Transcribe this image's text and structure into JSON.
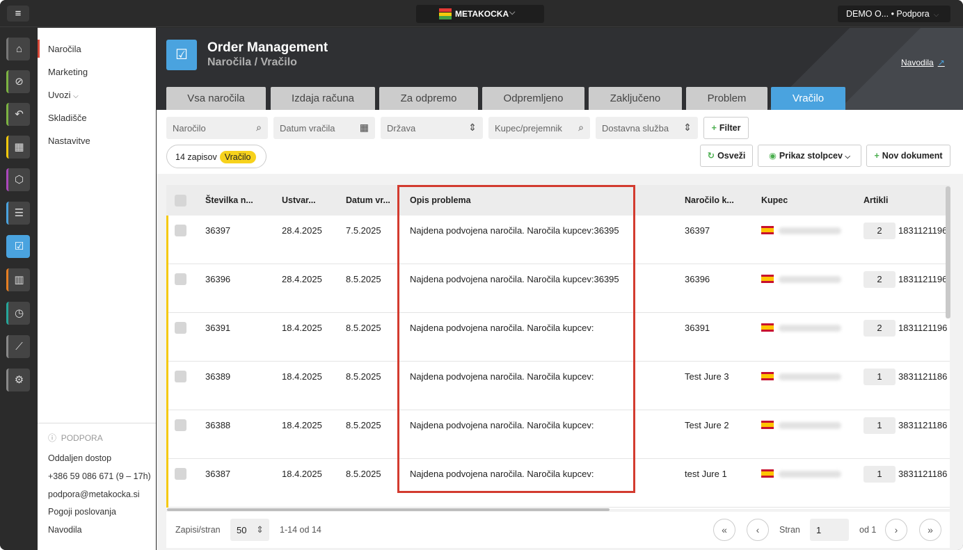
{
  "brand": {
    "name": "METAKOCKA",
    "logo_colors": [
      "#e53935",
      "#f5c90c",
      "#43a047"
    ]
  },
  "account": {
    "label": "DEMO O... • Podpora"
  },
  "icons": [
    "home-icon",
    "tag-icon",
    "return-icon",
    "calendar-icon",
    "box-icon",
    "invoice-icon",
    "order-icon",
    "factory-icon",
    "clock-icon",
    "chart-icon",
    "gear-icon"
  ],
  "nav": {
    "items": [
      "Naročila",
      "Marketing",
      "Uvozi",
      "Skladišče",
      "Nastavitve"
    ],
    "active": "Naročila"
  },
  "support": {
    "title": "PODPORA",
    "items": [
      "Oddaljen dostop",
      "+386 59 086 671 (9 – 17h)",
      "podpora@metakocka.si",
      "Pogoji poslovanja",
      "Navodila"
    ]
  },
  "header": {
    "title": "Order Management",
    "subtitle": "Naročila / Vračilo",
    "help": "Navodila"
  },
  "tabs": [
    "Vsa naročila",
    "Izdaja računa",
    "Za odpremo",
    "Odpremljeno",
    "Zaključeno",
    "Problem",
    "Vračilo"
  ],
  "active_tab": "Vračilo",
  "filters": {
    "order": "Naročilo",
    "return_date": "Datum vračila",
    "country": "Država",
    "buyer": "Kupec/prejemnik",
    "delivery": "Dostavna služba",
    "filter_btn": "Filter"
  },
  "actions": {
    "refresh": "Osveži",
    "columns": "Prikaz stolpcev",
    "new_doc": "Nov dokument"
  },
  "records": {
    "count": "14 zapisov",
    "status": "Vračilo"
  },
  "table": {
    "headers": [
      "Številka n...",
      "Ustvar...",
      "Datum vr...",
      "Opis problema",
      "Naročilo k...",
      "Kupec",
      "Artikli"
    ],
    "rows": [
      {
        "num": "36397",
        "created": "28.4.2025",
        "ret": "7.5.2025",
        "problem": "Najdena podvojena naročila. Naročila kupcev:36395",
        "order": "36397",
        "qty": "2",
        "sku": "1831121196"
      },
      {
        "num": "36396",
        "created": "28.4.2025",
        "ret": "8.5.2025",
        "problem": "Najdena podvojena naročila. Naročila kupcev:36395",
        "order": "36396",
        "qty": "2",
        "sku": "1831121196"
      },
      {
        "num": "36391",
        "created": "18.4.2025",
        "ret": "8.5.2025",
        "problem": "Najdena podvojena naročila. Naročila kupcev:",
        "order": "36391",
        "qty": "2",
        "sku": "1831121196"
      },
      {
        "num": "36389",
        "created": "18.4.2025",
        "ret": "8.5.2025",
        "problem": "Najdena podvojena naročila. Naročila kupcev:",
        "order": "Test Jure 3",
        "qty": "1",
        "sku": "3831121186"
      },
      {
        "num": "36388",
        "created": "18.4.2025",
        "ret": "8.5.2025",
        "problem": "Najdena podvojena naročila. Naročila kupcev:",
        "order": "Test Jure 2",
        "qty": "1",
        "sku": "3831121186"
      },
      {
        "num": "36387",
        "created": "18.4.2025",
        "ret": "8.5.2025",
        "problem": "Najdena podvojena naročila. Naročila kupcev:",
        "order": "test Jure 1",
        "qty": "1",
        "sku": "3831121186"
      }
    ]
  },
  "pagination": {
    "per_page_label": "Zapisi/stran",
    "per_page": "50",
    "range": "1-14 od 14",
    "page_label": "Stran",
    "page": "1",
    "of": "od 1"
  }
}
